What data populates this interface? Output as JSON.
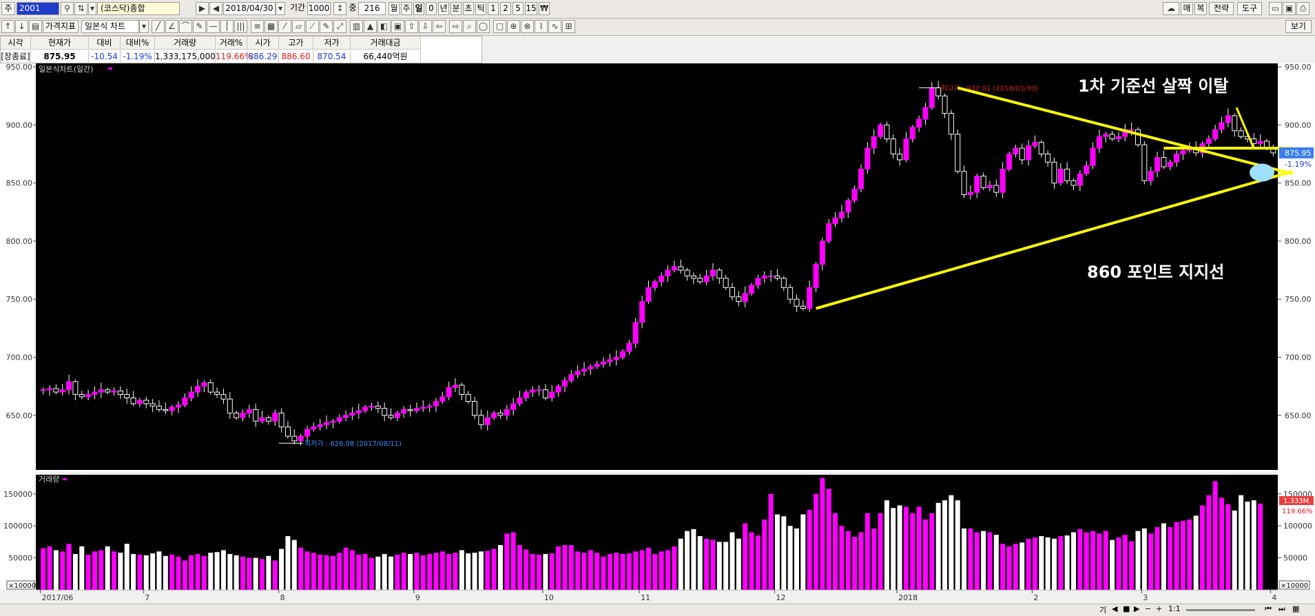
{
  "toolbar1": {
    "jong_label": "주",
    "code": "2001",
    "index_name": "(코스닥)종합",
    "date": "2018/04/30",
    "period_label": "기간",
    "period_value": "1000",
    "count_label": "중",
    "count_value": "216",
    "interval_buttons": [
      "월",
      "주",
      "일",
      "0",
      "년",
      "분",
      "초",
      "틱",
      "1",
      "2",
      "5",
      "15",
      "₩"
    ],
    "right_buttons": [
      "매",
      "복",
      "전략",
      "도구"
    ]
  },
  "toolbar2": {
    "indicator_button": "가격지표",
    "chart_type": "일본식 차트",
    "view_button": "보기"
  },
  "quote": {
    "headers": [
      "시각",
      "현재가",
      "대비",
      "대비%",
      "거래량",
      "거래%",
      "시가",
      "고가",
      "저가",
      "거래대금"
    ],
    "values": [
      "[장종료]",
      "875.95",
      "-10.54",
      "-1.19%",
      "1,333,175,000",
      "119.66%",
      "886.29",
      "886.60",
      "870.54",
      "66,440억원"
    ],
    "colors": [
      "#000000",
      "#000000",
      "#1b3ad2",
      "#1b3ad2",
      "#000000",
      "#e01b1b",
      "#1b3ad2",
      "#e01b1b",
      "#1b3ad2",
      "#000000"
    ]
  },
  "chart_data": {
    "type": "candlestick",
    "title": "일본식차트(일간)",
    "y_ticks": [
      650,
      700,
      750,
      800,
      850,
      900,
      950
    ],
    "y_tick_labels": [
      "650.00",
      "700.00",
      "750.00",
      "800.00",
      "850.00",
      "900.00",
      "950.00"
    ],
    "ylim": [
      603,
      953
    ],
    "x_labels": [
      {
        "label": "2017/06",
        "index": 0
      },
      {
        "label": "7",
        "index": 16
      },
      {
        "label": "8",
        "index": 37
      },
      {
        "label": "9",
        "index": 58
      },
      {
        "label": "10",
        "index": 78
      },
      {
        "label": "11",
        "index": 93
      },
      {
        "label": "12",
        "index": 114
      },
      {
        "label": "2018",
        "index": 133
      },
      {
        "label": "2",
        "index": 154
      },
      {
        "label": "3",
        "index": 171
      },
      {
        "label": "4",
        "index": 191
      }
    ],
    "bullish_color": "#ff00ff",
    "bearish_color": "#ffffff",
    "candle_close": [
      672,
      673,
      670,
      672,
      679,
      668,
      666,
      668,
      670,
      672,
      670,
      671,
      668,
      665,
      660,
      663,
      660,
      658,
      655,
      654,
      657,
      659,
      665,
      670,
      675,
      678,
      670,
      668,
      664,
      652,
      648,
      652,
      655,
      645,
      648,
      645,
      652,
      640,
      632,
      628,
      632,
      638,
      640,
      642,
      644,
      645,
      648,
      650,
      652,
      654,
      657,
      658,
      656,
      650,
      648,
      652,
      655,
      654,
      656,
      657,
      658,
      662,
      666,
      674,
      676,
      668,
      662,
      650,
      642,
      648,
      652,
      650,
      655,
      660,
      665,
      670,
      672,
      672,
      665,
      670,
      675,
      680,
      685,
      688,
      690,
      692,
      694,
      696,
      698,
      700,
      705,
      712,
      730,
      748,
      760,
      765,
      770,
      775,
      778,
      775,
      770,
      768,
      765,
      770,
      775,
      768,
      760,
      752,
      748,
      755,
      762,
      768,
      770,
      770,
      768,
      760,
      750,
      744,
      742,
      760,
      780,
      800,
      815,
      820,
      825,
      835,
      845,
      862,
      880,
      890,
      900,
      888,
      875,
      870,
      888,
      898,
      905,
      915,
      932,
      925,
      910,
      892,
      860,
      840,
      842,
      856,
      846,
      848,
      842,
      862,
      875,
      880,
      870,
      882,
      885,
      875,
      868,
      850,
      862,
      852,
      848,
      858,
      865,
      880,
      890,
      892,
      888,
      890,
      896,
      896,
      883,
      852,
      860,
      872,
      864,
      868,
      875,
      878,
      880,
      876,
      884,
      888,
      896,
      902,
      908,
      895,
      890,
      888,
      884,
      886,
      880,
      875.95
    ],
    "volume_values": [
      65,
      68,
      62,
      60,
      72,
      56,
      68,
      55,
      60,
      62,
      68,
      60,
      58,
      72,
      56,
      55,
      54,
      57,
      60,
      53,
      55,
      52,
      46,
      54,
      56,
      53,
      58,
      59,
      62,
      56,
      54,
      52,
      50,
      50,
      48,
      53,
      46,
      64,
      84,
      78,
      66,
      60,
      58,
      55,
      54,
      53,
      58,
      66,
      62,
      55,
      56,
      50,
      52,
      56,
      52,
      55,
      58,
      56,
      58,
      54,
      56,
      58,
      60,
      56,
      58,
      62,
      57,
      58,
      60,
      61,
      64,
      70,
      88,
      90,
      70,
      63,
      56,
      55,
      56,
      57,
      68,
      70,
      70,
      60,
      58,
      62,
      58,
      52,
      56,
      58,
      56,
      57,
      60,
      62,
      66,
      56,
      60,
      62,
      68,
      80,
      92,
      95,
      84,
      80,
      78,
      75,
      75,
      90,
      80,
      104,
      90,
      85,
      110,
      150,
      118,
      115,
      100,
      96,
      118,
      125,
      150,
      175,
      158,
      120,
      100,
      92,
      83,
      90,
      120,
      96,
      120,
      140,
      128,
      132,
      130,
      120,
      130,
      110,
      120,
      136,
      140,
      148,
      140,
      96,
      96,
      90,
      92,
      90,
      86,
      72,
      68,
      72,
      74,
      80,
      82,
      84,
      82,
      80,
      84,
      85,
      90,
      95,
      90,
      92,
      88,
      92,
      78,
      82,
      86,
      76,
      92,
      96,
      88,
      98,
      104,
      98,
      106,
      108,
      110,
      116,
      132,
      148,
      170,
      144,
      134,
      124,
      148,
      138,
      140,
      135
    ],
    "volume_y_ticks": [
      50000,
      100000,
      150000
    ],
    "volume_y_tick_labels": [
      "50000",
      "100000",
      "150000"
    ],
    "volume_unit_label": "×10000",
    "volume_panel_title": "거래량",
    "highest": {
      "label": "최고가 : 932.01 (2018/01/30)"
    },
    "lowest": {
      "label": "최저가 : 626.08 (2017/08/11)"
    },
    "current_price_label": "875.95",
    "current_change_label": "-1.19%",
    "current_volume_label": "1.333M",
    "current_volume_pct_label": "119.66%",
    "annotations": [
      {
        "text": "1차 기준선 살짝 이탈"
      },
      {
        "text": "860 포인트 지지선"
      }
    ],
    "trendlines": [
      {
        "from_price": [
          120,
          742
        ],
        "to_price": [
          194,
          860
        ],
        "color": "#ffff00"
      },
      {
        "from_price": [
          142,
          932
        ],
        "to_price": [
          194,
          858
        ],
        "color": "#ffff00"
      },
      {
        "from_price": [
          174,
          880
        ],
        "to_price": [
          194,
          880
        ],
        "color": "#ffff00"
      }
    ]
  },
  "status": {
    "buttons": [
      "기",
      "1:1"
    ]
  }
}
